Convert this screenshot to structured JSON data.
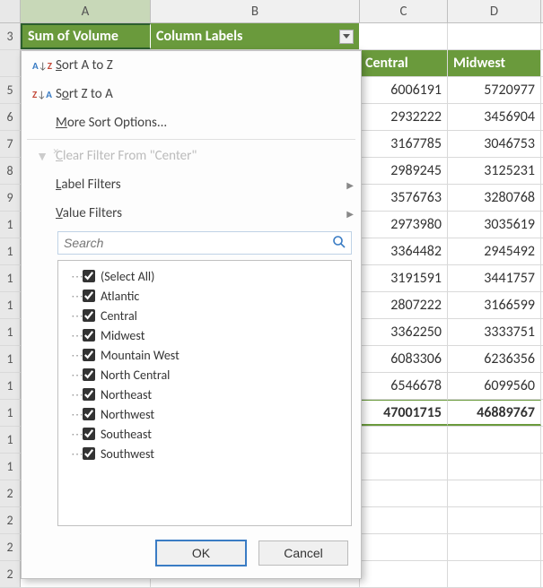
{
  "columns": {
    "rownum": "3",
    "A": "A",
    "B": "B",
    "C": "C",
    "D": "D"
  },
  "pivot": {
    "sumOf": "Sum of Volume",
    "colLabels": "Column Labels",
    "subheaders": {
      "C": "Central",
      "D": "Midwest"
    }
  },
  "data": {
    "rows": [
      {
        "C": "6006191",
        "D": "5720977"
      },
      {
        "C": "2932222",
        "D": "3456904"
      },
      {
        "C": "3167785",
        "D": "3046753"
      },
      {
        "C": "2989245",
        "D": "3125231"
      },
      {
        "C": "3576763",
        "D": "3280768"
      },
      {
        "C": "2973980",
        "D": "3035619"
      },
      {
        "C": "3364482",
        "D": "2945492"
      },
      {
        "C": "3191591",
        "D": "3441757"
      },
      {
        "C": "2807222",
        "D": "3166599"
      },
      {
        "C": "3362250",
        "D": "3333751"
      },
      {
        "C": "6083306",
        "D": "6236356"
      },
      {
        "C": "6546678",
        "D": "6099560"
      }
    ],
    "totals": {
      "C": "47001715",
      "D": "46889767"
    }
  },
  "dropdown": {
    "sortAZ": "Sort A to Z",
    "sortZA": "Sort Z to A",
    "moreSort": "More Sort Options...",
    "clearFilter": "Clear Filter From \"Center\"",
    "labelFilters": "Label Filters",
    "valueFilters": "Value Filters",
    "searchPlaceholder": "Search",
    "items": [
      "(Select All)",
      "Atlantic",
      "Central",
      "Midwest",
      "Mountain West",
      "North Central",
      "Northeast",
      "Northwest",
      "Southeast",
      "Southwest"
    ],
    "ok": "OK",
    "cancel": "Cancel"
  }
}
